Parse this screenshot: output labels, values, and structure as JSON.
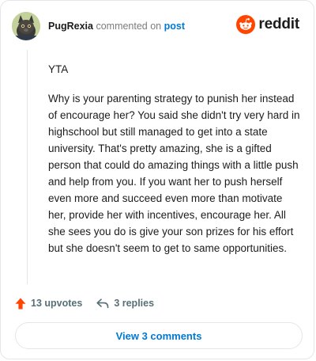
{
  "post": {
    "username": "PugRexia",
    "action_text": "commented on",
    "target_link": "post"
  },
  "brand": {
    "name": "reddit",
    "accent": "#FF4500",
    "link_color": "#0079D3",
    "logo_icon": "reddit-snoo-icon"
  },
  "comment": {
    "paragraphs": [
      "YTA",
      "Why is your parenting strategy to punish her instead of encourage her? You said she didn't try very hard in highschool but still managed to get into a state university. That's pretty amazing, she is a gifted person that could do amazing things with a little push and help from you. If you want her to push herself even more and succeed even more than motivate her, provide her with incentives, encourage her. All she sees you do is give your son prizes for his effort but she doesn't seem to get to same opportunities."
    ]
  },
  "stats": {
    "upvotes_label": "13 upvotes",
    "replies_label": "3 replies",
    "upvote_icon": "upvote-arrow-icon",
    "reply_icon": "reply-arrow-icon"
  },
  "footer": {
    "view_comments_label": "View 3 comments"
  }
}
